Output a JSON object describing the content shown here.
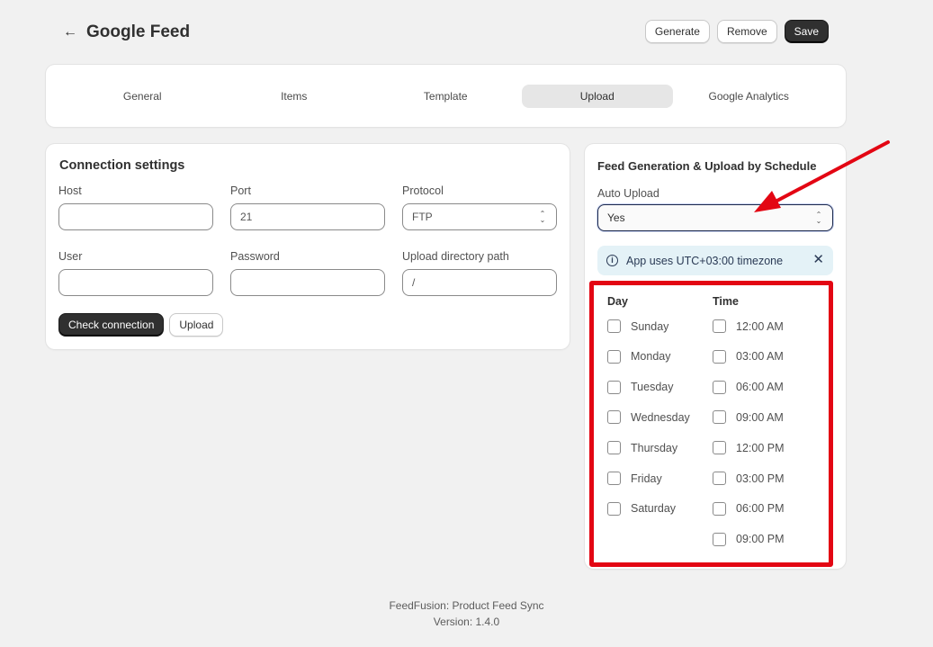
{
  "header": {
    "title": "Google Feed",
    "back_icon": "arrow-left-icon",
    "actions": {
      "generate": "Generate",
      "remove": "Remove",
      "save": "Save"
    }
  },
  "tabs": [
    {
      "label": "General",
      "active": false
    },
    {
      "label": "Items",
      "active": false
    },
    {
      "label": "Template",
      "active": false
    },
    {
      "label": "Upload",
      "active": true
    },
    {
      "label": "Google Analytics",
      "active": false
    }
  ],
  "connection": {
    "title": "Connection settings",
    "host": {
      "label": "Host",
      "value": ""
    },
    "port": {
      "label": "Port",
      "value": "21"
    },
    "protocol": {
      "label": "Protocol",
      "value": "FTP"
    },
    "user": {
      "label": "User",
      "value": ""
    },
    "password": {
      "label": "Password",
      "value": ""
    },
    "path": {
      "label": "Upload directory path",
      "value": "/"
    },
    "check_label": "Check connection",
    "upload_label": "Upload"
  },
  "schedule": {
    "title": "Feed Generation & Upload by Schedule",
    "auto_upload_label": "Auto Upload",
    "auto_upload_value": "Yes",
    "banner_text": "App uses UTC+03:00 timezone",
    "day_header": "Day",
    "time_header": "Time",
    "days": [
      "Sunday",
      "Monday",
      "Tuesday",
      "Wednesday",
      "Thursday",
      "Friday",
      "Saturday"
    ],
    "times": [
      "12:00 AM",
      "03:00 AM",
      "06:00 AM",
      "09:00 AM",
      "12:00 PM",
      "03:00 PM",
      "06:00 PM",
      "09:00 PM"
    ]
  },
  "footer": {
    "line1": "FeedFusion: Product Feed Sync",
    "line2": "Version: 1.4.0"
  },
  "colors": {
    "annotation_red": "#e30613",
    "primary_button": "#303030",
    "banner_bg": "#e4f2f7"
  }
}
